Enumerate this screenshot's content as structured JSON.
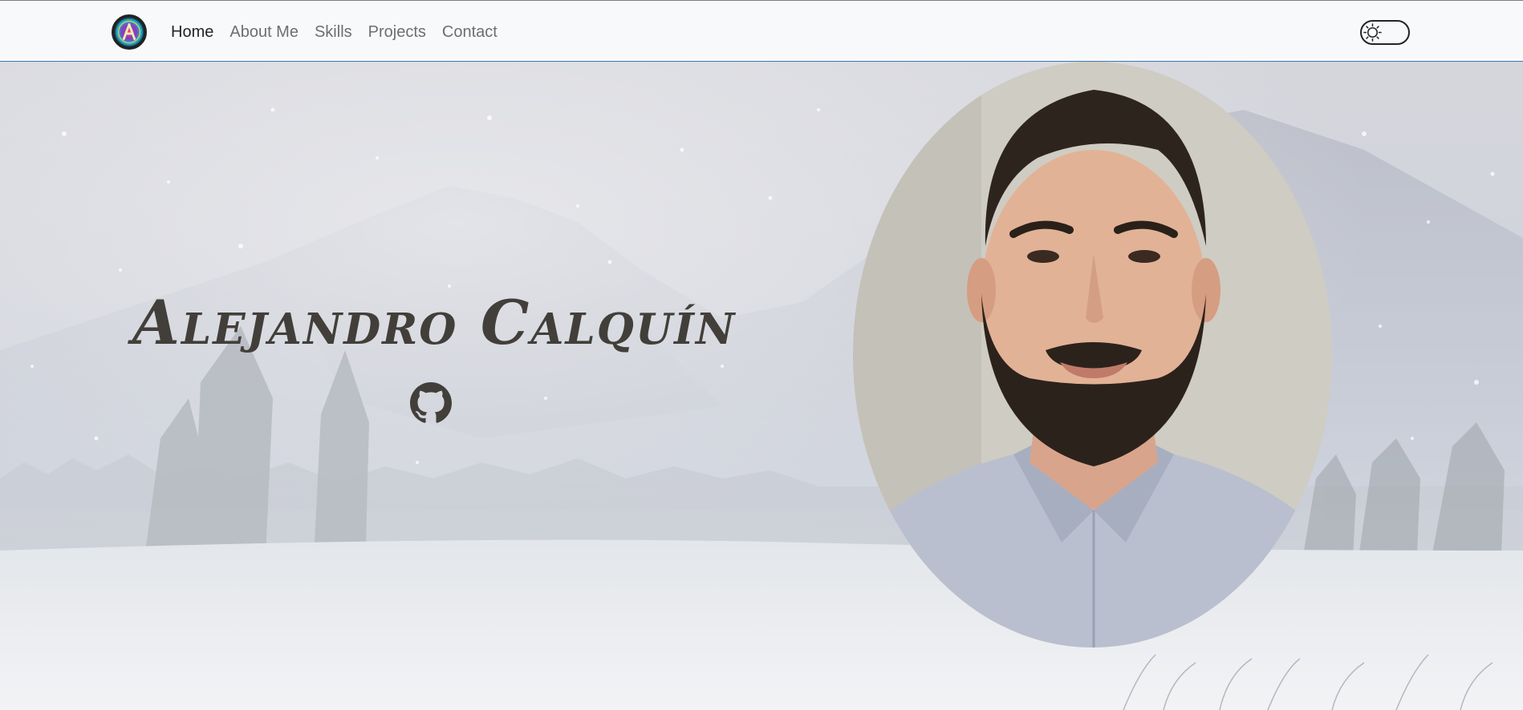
{
  "navbar": {
    "logo_icon": "logo-a-icon",
    "links": [
      {
        "label": "Home",
        "active": true
      },
      {
        "label": "About Me",
        "active": false
      },
      {
        "label": "Skills",
        "active": false
      },
      {
        "label": "Projects",
        "active": false
      },
      {
        "label": "Contact",
        "active": false
      }
    ],
    "theme_toggle_icon": "sun-icon",
    "theme_toggle_state": "off"
  },
  "hero": {
    "name": "Alejandro Calquín",
    "github_icon": "github-icon",
    "background": "snowy-mountain-landscape",
    "portrait": "profile-photo"
  },
  "colors": {
    "nav_bg": "#f8f9fa",
    "nav_active": "#212529",
    "nav_inactive": "#6b6f74",
    "nav_border": "#3d7ab0",
    "title_text": "#423f3a"
  }
}
